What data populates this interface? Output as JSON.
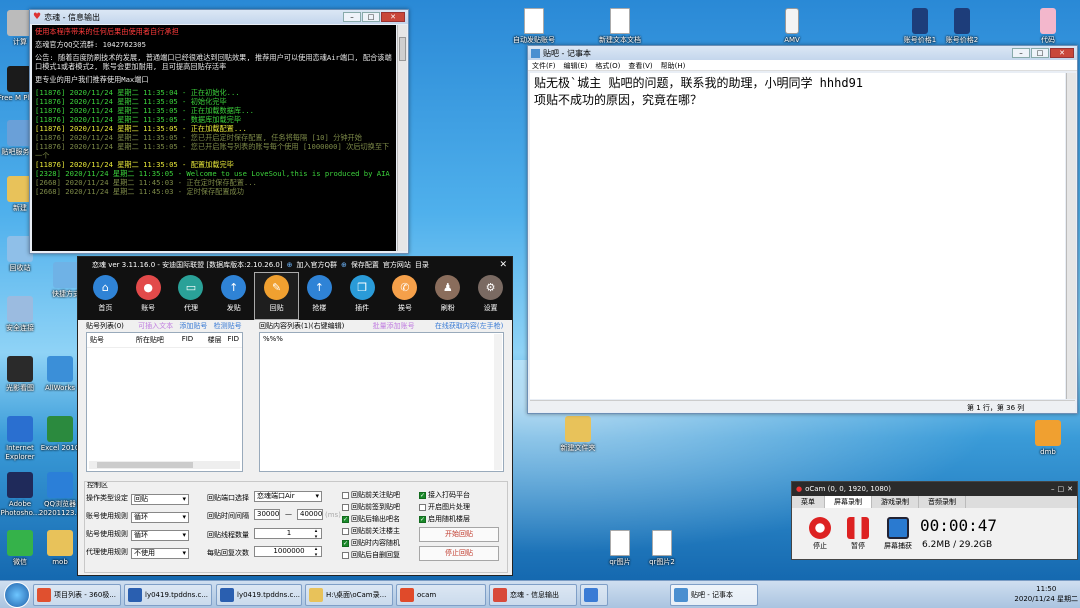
{
  "colors": {
    "console_bg": "#000000",
    "console_red": "#ff3b3b",
    "console_green": "#3cd23c",
    "console_yellow": "#e8e83a",
    "app_dark": "#111111",
    "accent_red": "#c0392b"
  },
  "desktop": {
    "left_icons": [
      "计算",
      "Free M Playe",
      "贴吧服务 表",
      "新建",
      "回收站",
      "安全连接",
      "光影看图",
      "AllWorks",
      "Internet Explorer",
      "Excel 2010",
      "Adobe Photosho...",
      "QQ浏览器 20201123...",
      "微信",
      "mob"
    ],
    "mid_icons": [
      "快捷方式"
    ],
    "top_icons": [
      "自动发贴账号",
      "新建文本文档",
      "AMV",
      "账号价格1",
      "账号价格2",
      "代码"
    ],
    "right_icons": [
      "dmb"
    ],
    "folder_icon": "新建文件夹",
    "bottom_icons": [
      "qr图片",
      "qr图片2"
    ]
  },
  "console_window": {
    "title": "恋魂 - 信息输出",
    "lines": [
      {
        "text": "使用本程序带来的任何后果由使用者自行承担",
        "color": "red"
      },
      {
        "text": "",
        "color": "white"
      },
      {
        "text": "恋魂官方QQ交流群: 1042762305",
        "color": "white"
      },
      {
        "text": "",
        "color": "white"
      },
      {
        "text": "公告: 随着百度防刷技术的发展, 普通端口已经很难达到回贴效果, 推荐用户可以使用恋魂Air端口, 配合该端口模式1或者模式2, 账号会更加耐用, 且可提高回贴存活率",
        "color": "white"
      },
      {
        "text": "",
        "color": "white"
      },
      {
        "text": "更专业的用户我们推荐使用Max端口",
        "color": "white"
      },
      {
        "text": "",
        "color": "white"
      },
      {
        "text": "[11876] 2020/11/24 星期二 11:35:04 - 正在初始化...",
        "color": "green"
      },
      {
        "text": "[11876] 2020/11/24 星期二 11:35:05 - 初始化完毕",
        "color": "green"
      },
      {
        "text": "[11876] 2020/11/24 星期二 11:35:05 - 正在加载数据库...",
        "color": "green"
      },
      {
        "text": "[11876] 2020/11/24 星期二 11:35:05 - 数据库加载完毕",
        "color": "green"
      },
      {
        "text": "[11876] 2020/11/24 星期二 11:35:05 - 正在加载配置...",
        "color": "yellow"
      },
      {
        "text": "[11876] 2020/11/24 星期二 11:35:05 - 您已开启定时保存配置, 任务将每隔 [10] 分钟开始",
        "color": "dim"
      },
      {
        "text": "[11876] 2020/11/24 星期二 11:35:05 - 您已开启账号列表的账号每个使用 [1000000] 次后切换至下一个",
        "color": "dim"
      },
      {
        "text": "[11876] 2020/11/24 星期二 11:35:05 - 配置加载完毕",
        "color": "yellow"
      },
      {
        "text": "[2328] 2020/11/24 星期二 11:35:05 - Welcome to use LoveSoul,this is produced by AIA",
        "color": "green"
      },
      {
        "text": "[2668] 2020/11/24 星期二 11:45:03 - 正在定时保存配置...",
        "color": "dim"
      },
      {
        "text": "[2668] 2020/11/24 星期二 11:45:03 - 定时保存配置成功",
        "color": "dim"
      }
    ]
  },
  "notepad": {
    "title": "贴吧 - 记事本",
    "menus": [
      "文件(F)",
      "编辑(E)",
      "格式(O)",
      "查看(V)",
      "帮助(H)"
    ],
    "line1": "贴无极`城主   贴吧的问题，联系我的助理，小明同学   hhhd91",
    "line2": "项贴不成功的原因，究竟在哪？",
    "status": "第 1 行，第 36 列"
  },
  "app": {
    "title": "恋魂 ver 3.11.16.0 - 安迪国际联盟 [数据库版本:2.10.26.0]",
    "title_links": [
      "加入官方Q群",
      "保存配置",
      "官方网站",
      "目录"
    ],
    "nav": [
      {
        "label": "首页",
        "color": "#2f83d6",
        "glyph": "⌂"
      },
      {
        "label": "账号",
        "color": "#e24a4a",
        "glyph": "●"
      },
      {
        "label": "代理",
        "color": "#2aa198",
        "glyph": "▭"
      },
      {
        "label": "发贴",
        "color": "#2f83d6",
        "glyph": "↑"
      },
      {
        "label": "回贴",
        "color": "#f0a030",
        "glyph": "✎"
      },
      {
        "label": "抢楼",
        "color": "#2f83d6",
        "glyph": "↑"
      },
      {
        "label": "插件",
        "color": "#2a9bd8",
        "glyph": "❐"
      },
      {
        "label": "挨号",
        "color": "#f5a04a",
        "glyph": "✆"
      },
      {
        "label": "刷粉",
        "color": "#8a6d5c",
        "glyph": "♟"
      },
      {
        "label": "设置",
        "color": "#7a6a62",
        "glyph": "⚙"
      }
    ],
    "active_nav": "回贴",
    "list_section": {
      "title": "贴号列表(0)",
      "link1": "可插入文本",
      "link2": "添加贴号",
      "link3": "检测贴号",
      "columns": [
        "贴号",
        "所在贴吧",
        "FID",
        "楼层",
        "FID"
      ]
    },
    "content_section": {
      "title": "回贴内容列表(1)(右键编辑)",
      "link1": "批量添加账号",
      "link2": "在线获取内容(左手枪)",
      "entry": "%%%"
    },
    "control_title": "控制区",
    "left_fields": [
      {
        "label": "操作类型设定",
        "value": "回贴"
      },
      {
        "label": "账号使用规则",
        "value": "循环"
      },
      {
        "label": "贴号使用规则",
        "value": "循环"
      },
      {
        "label": "代理使用规则",
        "value": "不使用"
      }
    ],
    "mid_fields": {
      "port_label": "回贴端口选择",
      "port_value": "恋魂端口Air",
      "interval_label": "回贴时间间隔",
      "interval_min": "30000",
      "interval_max": "40000",
      "interval_unit": "(ms)",
      "threads_label": "回贴线程数量",
      "threads_value": "1",
      "loops_label": "每贴回复次数",
      "loops_value": "1000000"
    },
    "checks_left": [
      {
        "label": "回贴前关注贴吧",
        "checked": false
      },
      {
        "label": "回贴前签到贴吧",
        "checked": false
      },
      {
        "label": "回贴后输出吧名",
        "checked": true
      },
      {
        "label": "回贴前关注楼主",
        "checked": false
      },
      {
        "label": "回贴时内容随机",
        "checked": true
      },
      {
        "label": "回贴后自删回复",
        "checked": false
      }
    ],
    "checks_right": [
      {
        "label": "接入打码平台",
        "checked": true
      },
      {
        "label": "开启图片处理",
        "checked": false
      },
      {
        "label": "启用随机楼层",
        "checked": true
      }
    ],
    "start_button": "开始回贴",
    "stop_button": "停止回贴"
  },
  "ocam": {
    "title": "oCam (0, 0, 1920, 1080)",
    "tabs": [
      "菜单",
      "屏幕录制",
      "游戏录制",
      "音频录制"
    ],
    "active_tab": "屏幕录制",
    "buttons": [
      "停止",
      "暂停",
      "屏幕捕获"
    ],
    "timer": "00:00:47",
    "size": "6.2MB / 29.2GB"
  },
  "taskbar": {
    "items": [
      "项目列表 - 360极...",
      "ly0419.tpddns.c...",
      "ly0419.tpddns.c...",
      "H:\\桌面\\oCam录...",
      "ocam",
      "恋魂 - 信息输出",
      "",
      "贴吧 - 记事本"
    ],
    "time": "11:50",
    "date": "2020/11/24 星期二"
  }
}
